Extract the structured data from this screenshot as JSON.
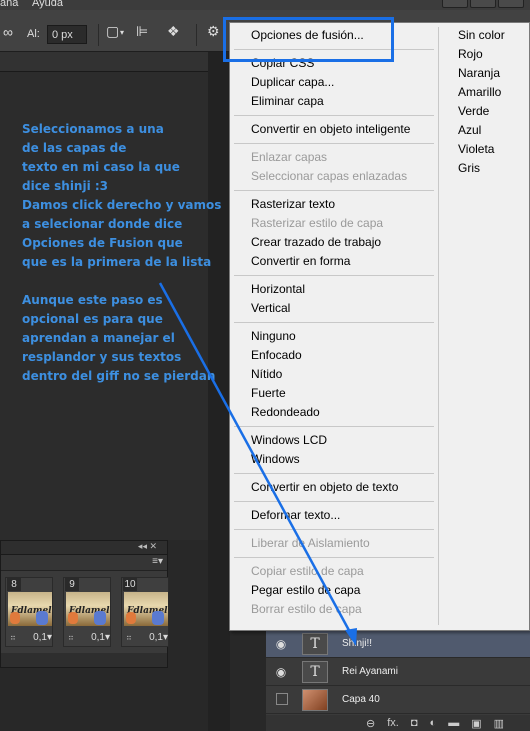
{
  "menubar": {
    "left_item": "ana",
    "help": "Ayuda"
  },
  "options": {
    "align_label": "Al:",
    "px_value": "0 px"
  },
  "tutorial": {
    "para1": [
      "Seleccionamos a una",
      "de las capas de",
      "texto en mi caso la que",
      "dice shinji :3",
      "Damos click derecho y vamos",
      "a selecionar donde dice",
      "Opciones de Fusion que",
      "que es la primera de la lista"
    ],
    "para2": [
      "Aunque este paso es",
      "opcional es para que",
      "aprendan a manejar el",
      "resplandor y sus textos",
      "dentro del giff no se pierdan"
    ]
  },
  "timeline": {
    "frames": [
      {
        "num": "8",
        "delay": "0,1▾",
        "thumb_text": "Fdlamel!"
      },
      {
        "num": "9",
        "delay": "0,1▾",
        "thumb_text": "Fdlamel!"
      },
      {
        "num": "10",
        "delay": "0,1▾",
        "thumb_text": "Fdlamel!"
      }
    ]
  },
  "layers": {
    "rows": [
      {
        "name": "Shinji!!",
        "kind": "text",
        "selected": true
      },
      {
        "name": "Rei Ayanami",
        "kind": "text",
        "selected": false
      },
      {
        "name": "Capa 40",
        "kind": "image",
        "selected": false
      }
    ],
    "footer_fx": "fx."
  },
  "context_menu": {
    "groups": [
      [
        {
          "label": "Opciones de fusión...",
          "enabled": true
        }
      ],
      [
        {
          "label": "Copiar CSS",
          "enabled": true
        },
        {
          "label": "Duplicar capa...",
          "enabled": true
        },
        {
          "label": "Eliminar capa",
          "enabled": true
        }
      ],
      [
        {
          "label": "Convertir en objeto inteligente",
          "enabled": true
        }
      ],
      [
        {
          "label": "Enlazar capas",
          "enabled": false
        },
        {
          "label": "Seleccionar capas enlazadas",
          "enabled": false
        }
      ],
      [
        {
          "label": "Rasterizar texto",
          "enabled": true
        },
        {
          "label": "Rasterizar estilo de capa",
          "enabled": false
        },
        {
          "label": "Crear trazado de trabajo",
          "enabled": true
        },
        {
          "label": "Convertir en forma",
          "enabled": true
        }
      ],
      [
        {
          "label": "Horizontal",
          "enabled": true
        },
        {
          "label": "Vertical",
          "enabled": true
        }
      ],
      [
        {
          "label": "Ninguno",
          "enabled": true
        },
        {
          "label": "Enfocado",
          "enabled": true
        },
        {
          "label": "Nítido",
          "enabled": true
        },
        {
          "label": "Fuerte",
          "enabled": true
        },
        {
          "label": "Redondeado",
          "enabled": true
        }
      ],
      [
        {
          "label": "Windows LCD",
          "enabled": true
        },
        {
          "label": "Windows",
          "enabled": true
        }
      ],
      [
        {
          "label": "Convertir en objeto de texto",
          "enabled": true
        }
      ],
      [
        {
          "label": "Deformar texto...",
          "enabled": true
        }
      ],
      [
        {
          "label": "Liberar de Aislamiento",
          "enabled": false
        }
      ],
      [
        {
          "label": "Copiar estilo de capa",
          "enabled": false
        },
        {
          "label": "Pegar estilo de capa",
          "enabled": true
        },
        {
          "label": "Borrar estilo de capa",
          "enabled": false
        }
      ]
    ],
    "colors": [
      "Sin color",
      "Rojo",
      "Naranja",
      "Amarillo",
      "Verde",
      "Azul",
      "Violeta",
      "Gris"
    ]
  },
  "accent_colors": {
    "annotation_blue": "#1a6fe6",
    "tutorial_text": "#3d8fe0"
  }
}
